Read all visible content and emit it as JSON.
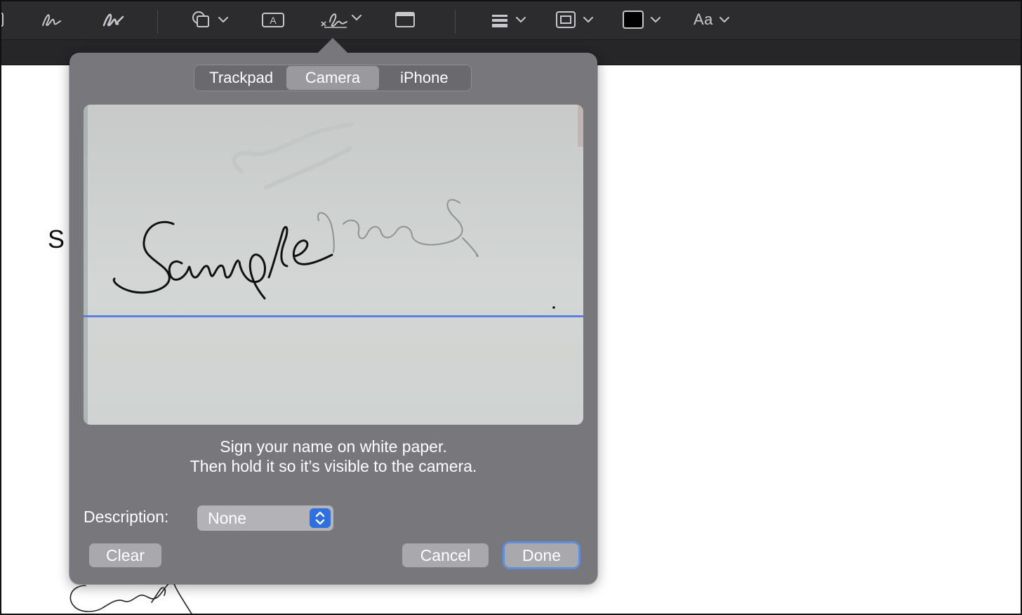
{
  "toolbar": {
    "tools": [
      {
        "name": "sketch-icon"
      },
      {
        "name": "draw-icon"
      },
      {
        "name": "shapes-icon"
      },
      {
        "name": "text-box-icon"
      },
      {
        "name": "sign-icon"
      },
      {
        "name": "note-icon"
      },
      {
        "name": "line-style-icon"
      },
      {
        "name": "border-color-icon"
      },
      {
        "name": "fill-color-icon"
      }
    ],
    "text_style_label": "Aa",
    "fill_color": "#000000"
  },
  "document": {
    "visible_text": "S"
  },
  "signature_popover": {
    "tabs": [
      {
        "label": "Trackpad",
        "active": false
      },
      {
        "label": "Camera",
        "active": true
      },
      {
        "label": "iPhone",
        "active": false
      }
    ],
    "camera_preview": {
      "signature_text": "Sample",
      "guide_line_color": "#5b7fe0"
    },
    "instructions_line1": "Sign your name on white paper.",
    "instructions_line2": "Then hold it so it’s visible to the camera.",
    "description_label": "Description:",
    "description_value": "None",
    "buttons": {
      "clear": "Clear",
      "cancel": "Cancel",
      "done": "Done"
    }
  }
}
